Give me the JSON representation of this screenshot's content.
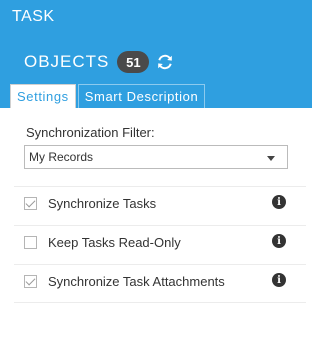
{
  "colors": {
    "accent": "#2f9fe0",
    "badge": "#4a4a4a"
  },
  "header": {
    "title": "TASK",
    "objects_label": "OBJECTS",
    "objects_count": "51",
    "sync_icon": "refresh-icon"
  },
  "tabs": [
    {
      "label": "Settings",
      "active": true
    },
    {
      "label": "Smart Description",
      "active": false
    }
  ],
  "filter": {
    "label": "Synchronization Filter:",
    "selected": "My Records"
  },
  "options": [
    {
      "label": "Synchronize Tasks",
      "checked": true,
      "icon": "info-icon"
    },
    {
      "label": "Keep Tasks Read-Only",
      "checked": false,
      "icon": "info-icon"
    },
    {
      "label": "Synchronize Task Attachments",
      "checked": true,
      "icon": "info-icon"
    }
  ]
}
